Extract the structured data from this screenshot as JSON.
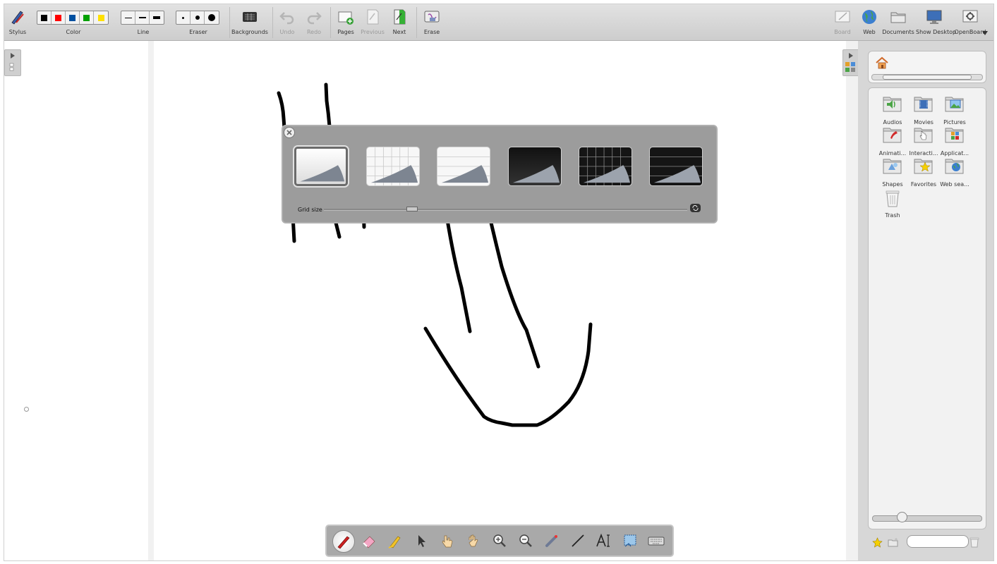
{
  "toolbar": {
    "stylus": "Stylus",
    "color": "Color",
    "line": "Line",
    "eraser": "Eraser",
    "backgrounds": "Backgrounds",
    "undo": "Undo",
    "redo": "Redo",
    "pages": "Pages",
    "previous": "Previous",
    "next": "Next",
    "erase": "Erase",
    "board": "Board",
    "web": "Web",
    "documents": "Documents",
    "show_desktop": "Show Desktop",
    "openboard": "OpenBoard",
    "colors": [
      "#000000",
      "#ff0000",
      "#0050a0",
      "#00a000",
      "#ffe000"
    ]
  },
  "background_popup": {
    "grid_size_label": "Grid size",
    "selected_index": 0
  },
  "library": {
    "folders": [
      {
        "label": "Audios",
        "icon": "audio-folder-icon"
      },
      {
        "label": "Movies",
        "icon": "movie-folder-icon"
      },
      {
        "label": "Pictures",
        "icon": "picture-folder-icon"
      },
      {
        "label": "Animati...",
        "icon": "animation-folder-icon"
      },
      {
        "label": "Interacti...",
        "icon": "interactive-folder-icon"
      },
      {
        "label": "Applicat...",
        "icon": "application-folder-icon"
      },
      {
        "label": "Shapes",
        "icon": "shapes-folder-icon"
      },
      {
        "label": "Favorites",
        "icon": "favorites-folder-icon"
      },
      {
        "label": "Web sea...",
        "icon": "web-search-folder-icon"
      },
      {
        "label": "Trash",
        "icon": "trash-icon"
      }
    ],
    "search_placeholder": ""
  },
  "bottom_tools": [
    "pen-icon",
    "eraser-icon",
    "highlighter-icon",
    "pointer-icon",
    "interact-hand-icon",
    "pan-hand-icon",
    "zoom-in-icon",
    "zoom-out-icon",
    "laser-icon",
    "line-icon",
    "text-icon",
    "capture-icon",
    "keyboard-icon"
  ]
}
